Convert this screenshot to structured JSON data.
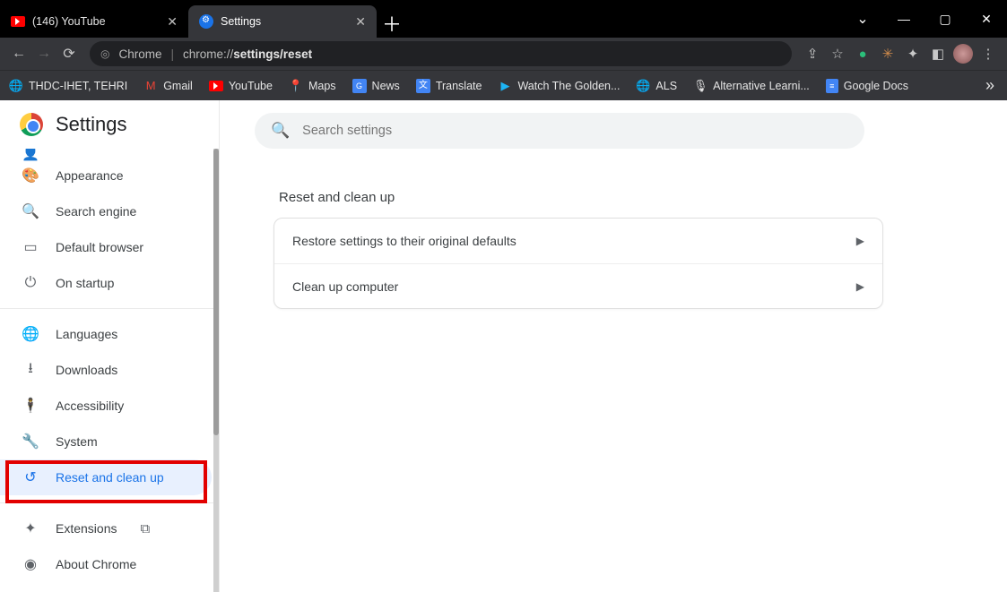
{
  "window": {
    "tabs": [
      {
        "label": "(146) YouTube",
        "icon": "youtube-icon",
        "active": false
      },
      {
        "label": "Settings",
        "icon": "settings-gear-icon",
        "active": true
      }
    ],
    "controls": [
      "minimize",
      "maximize",
      "close"
    ]
  },
  "toolbar": {
    "secure_label": "Chrome",
    "url_prefix": "chrome://",
    "url_bold": "settings/reset",
    "url_rest": ""
  },
  "bookmarks": [
    {
      "label": "THDC-IHET, TEHRI",
      "icon": "globe-icon"
    },
    {
      "label": "Gmail",
      "icon": "gmail-icon"
    },
    {
      "label": "YouTube",
      "icon": "youtube-icon"
    },
    {
      "label": "Maps",
      "icon": "maps-icon"
    },
    {
      "label": "News",
      "icon": "news-icon"
    },
    {
      "label": "Translate",
      "icon": "translate-icon"
    },
    {
      "label": "Watch The Golden...",
      "icon": "play-icon"
    },
    {
      "label": "ALS",
      "icon": "globe-icon"
    },
    {
      "label": "Alternative Learni...",
      "icon": "sound-icon"
    },
    {
      "label": "Google Docs",
      "icon": "docs-icon"
    }
  ],
  "settings": {
    "header": "Settings",
    "search_placeholder": "Search settings",
    "section_title": "Reset and clean up",
    "rows": [
      "Restore settings to their original defaults",
      "Clean up computer"
    ],
    "menu": [
      {
        "label": "",
        "icon": "person-icon",
        "cutoff": true
      },
      {
        "label": "Appearance",
        "icon": "palette-icon"
      },
      {
        "label": "Search engine",
        "icon": "search-icon"
      },
      {
        "label": "Default browser",
        "icon": "browser-icon"
      },
      {
        "label": "On startup",
        "icon": "power-icon"
      },
      {
        "divider": true
      },
      {
        "label": "Languages",
        "icon": "globe-icon"
      },
      {
        "label": "Downloads",
        "icon": "download-icon"
      },
      {
        "label": "Accessibility",
        "icon": "accessibility-icon"
      },
      {
        "label": "System",
        "icon": "wrench-icon"
      },
      {
        "label": "Reset and clean up",
        "icon": "restore-icon",
        "active": true
      },
      {
        "divider": true
      },
      {
        "label": "Extensions",
        "icon": "extension-icon",
        "open": true
      },
      {
        "label": "About Chrome",
        "icon": "chrome-icon"
      }
    ]
  }
}
